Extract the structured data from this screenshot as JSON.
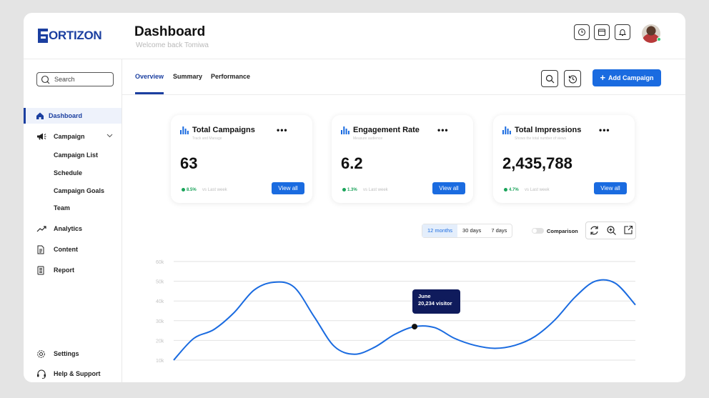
{
  "brand": {
    "name": "FORTIZON",
    "logo_text": "ORTIZON",
    "accent": "#1a6be0",
    "dark_accent": "#1b3fa0"
  },
  "header": {
    "title": "Dashboard",
    "subtitle": "Welcome back Tomiwa"
  },
  "sidebar": {
    "search_placeholder": "Search",
    "items": [
      {
        "label": "Dashboard",
        "icon": "home-icon",
        "active": true
      },
      {
        "label": "Campaign",
        "icon": "megaphone-icon",
        "expanded": true,
        "children": [
          "Campaign List",
          "Schedule",
          "Campaign Goals",
          "Team"
        ]
      },
      {
        "label": "Analytics",
        "icon": "trend-icon"
      },
      {
        "label": "Content",
        "icon": "document-icon"
      },
      {
        "label": "Report",
        "icon": "report-icon"
      }
    ],
    "bottom": [
      {
        "label": "Settings",
        "icon": "gear-icon"
      },
      {
        "label": "Help & Support",
        "icon": "headset-icon"
      }
    ]
  },
  "tabs": [
    "Overview",
    "Summary",
    "Performance"
  ],
  "actions": {
    "add_campaign": "Add Campaign"
  },
  "cards": [
    {
      "title": "Total Campaigns",
      "subtitle": "Track and Manage",
      "value": "63",
      "trend": "8.5%",
      "trend_label": "vs Last week",
      "button": "View all"
    },
    {
      "title": "Engagement Rate",
      "subtitle": "Measure audience",
      "value": "6.2",
      "trend": "1.3%",
      "trend_label": "vs Last week",
      "button": "View all"
    },
    {
      "title": "Total Impressions",
      "subtitle": "Shows the total number of views",
      "value": "2,435,788",
      "trend": "4.7%",
      "trend_label": "vs Last week",
      "button": "View all"
    }
  ],
  "chart_controls": {
    "ranges": [
      "12 months",
      "30 days",
      "7 days"
    ],
    "selected_range": "12 months",
    "comparison_label": "Comparison",
    "comparison_on": false
  },
  "chart_data": {
    "type": "line",
    "y_ticks": [
      "60k",
      "50k",
      "40k",
      "30k",
      "20k",
      "10k"
    ],
    "ylim": [
      10000,
      60000
    ],
    "grid": true,
    "x": [
      0,
      0.5,
      1,
      1.5,
      2,
      2.5,
      3,
      3.5,
      4,
      4.5,
      5,
      5.5,
      6,
      6.5,
      7,
      7.5,
      8,
      8.5,
      9,
      9.5,
      10,
      10.5,
      11,
      11.5
    ],
    "series": [
      {
        "color": "#1a6be0",
        "values": [
          10000,
          21000,
          25500,
          34000,
          45500,
          49500,
          47000,
          32000,
          17000,
          13000,
          16500,
          23000,
          27000,
          26500,
          21000,
          17500,
          16000,
          17500,
          22000,
          30500,
          42000,
          50000,
          49000,
          38000
        ]
      }
    ],
    "highlight": {
      "index": 12,
      "label": "June",
      "value_text": "20,234 visitor"
    }
  }
}
